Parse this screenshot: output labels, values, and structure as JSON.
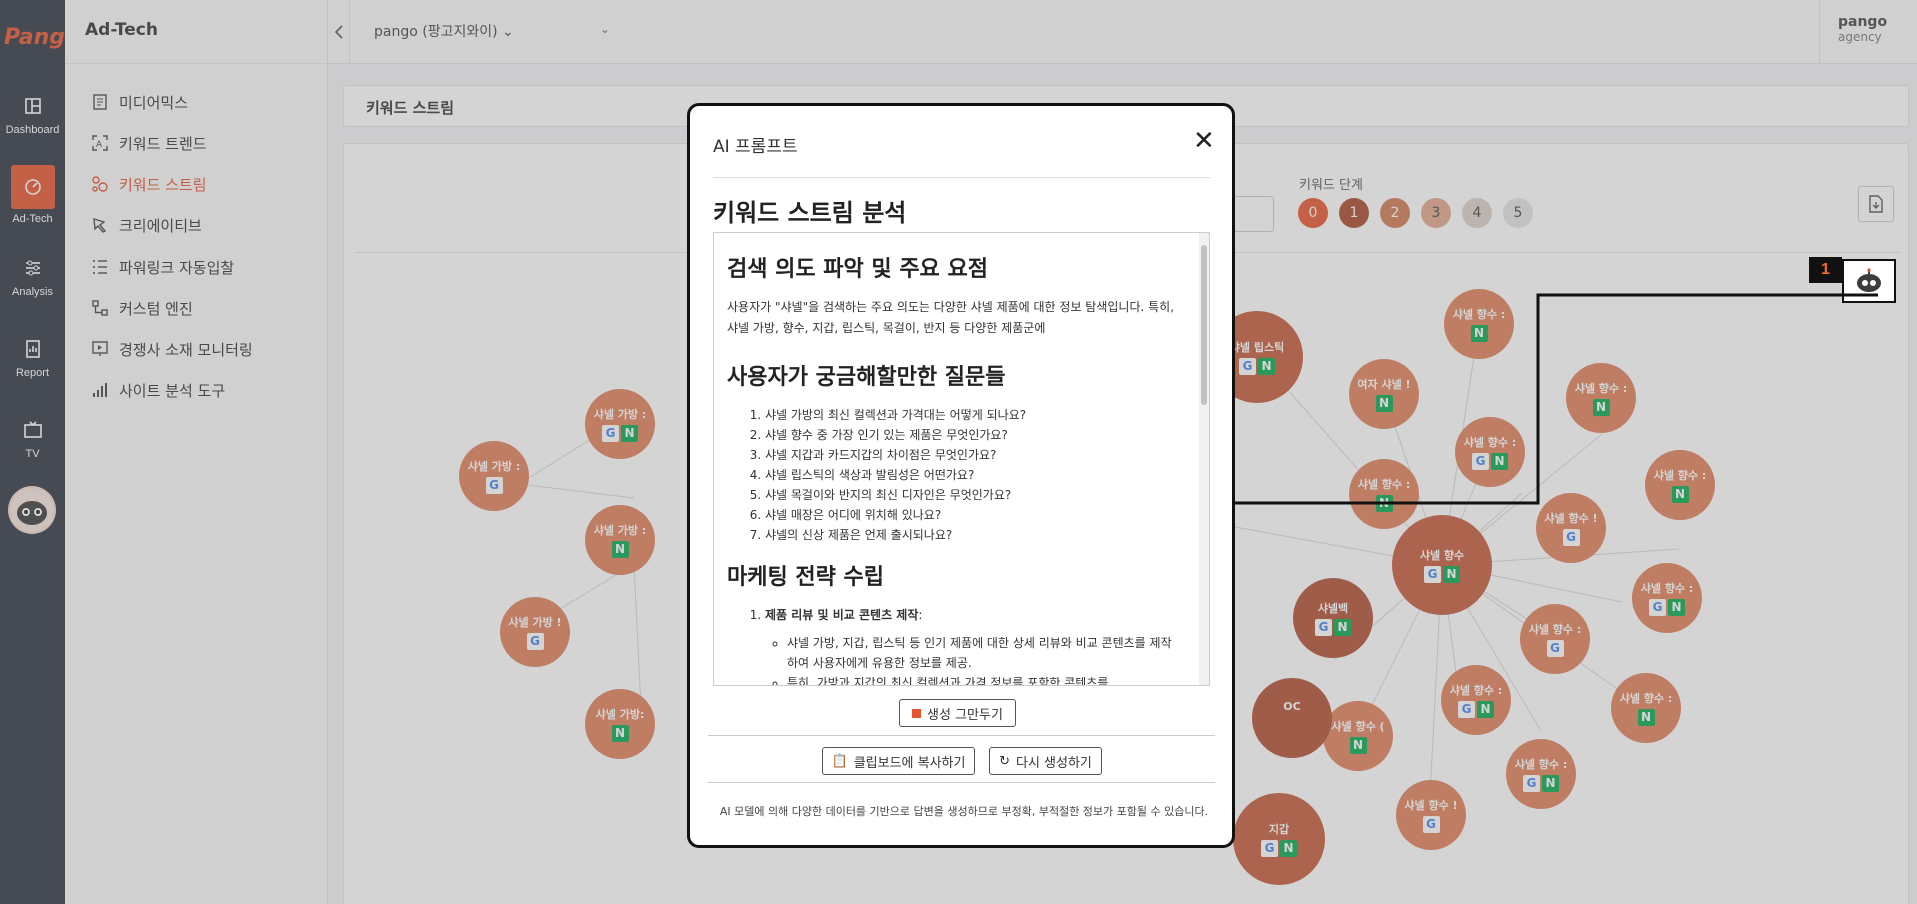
{
  "rail": {
    "logo_text": "Pango",
    "items": [
      {
        "label": "Dashboard",
        "icon": "dashboard-icon"
      },
      {
        "label": "Ad-Tech",
        "icon": "gauge-icon"
      },
      {
        "label": "Analysis",
        "icon": "sliders-icon"
      },
      {
        "label": "Report",
        "icon": "report-icon"
      },
      {
        "label": "TV",
        "icon": "tv-icon"
      }
    ]
  },
  "side": {
    "brand": "Ad-Tech",
    "items": [
      {
        "label": "미디어믹스"
      },
      {
        "label": "키워드 트렌드"
      },
      {
        "label": "키워드 스트림"
      },
      {
        "label": "크리에이티브"
      },
      {
        "label": "파워링크 자동입찰"
      },
      {
        "label": "커스텀 엔진"
      },
      {
        "label": "경쟁사 소재 모니터링"
      },
      {
        "label": "사이트 분석 도구"
      }
    ]
  },
  "header": {
    "account": "pango (팡고지와이)",
    "user_name": "pango",
    "user_role": "agency"
  },
  "breadcrumb": "키워드 스트림",
  "content": {
    "stage_title": "키워드 단계",
    "stages": [
      "0",
      "1",
      "2",
      "3",
      "4",
      "5"
    ],
    "nodes": [
      {
        "name": "샤넬 립스틱",
        "g": true,
        "n": true
      },
      {
        "name": "샤넬 향수 :",
        "g": false,
        "n": true
      },
      {
        "name": "여자 샤넬 !",
        "g": false,
        "n": true
      },
      {
        "name": "샤넬 향수 :",
        "g": false,
        "n": true
      },
      {
        "name": "샤넬 향수 :",
        "g": true,
        "n": true
      },
      {
        "name": "샤넬 향수 :",
        "g": false,
        "n": true
      },
      {
        "name": "샤넬 향수 :",
        "g": false,
        "n": true
      },
      {
        "name": "샤넬 향수 !",
        "g": true,
        "n": false
      },
      {
        "name": "샤넬 향수",
        "g": true,
        "n": true
      },
      {
        "name": "샤넬백",
        "g": true,
        "n": true
      },
      {
        "name": "샤넬 향수 :",
        "g": true,
        "n": true
      },
      {
        "name": "샤넬 향수 :",
        "g": true,
        "n": false
      },
      {
        "name": "샤넬 향수 :",
        "g": true,
        "n": true
      },
      {
        "name": "샤넬 향수 :",
        "g": false,
        "n": true
      },
      {
        "name": "샤넬 향수 (",
        "g": false,
        "n": true
      },
      {
        "name": "샤넬 향수 :",
        "g": true,
        "n": true
      },
      {
        "name": "샤넬 향수 !",
        "g": true,
        "n": false
      },
      {
        "name": "샤넬 가방 :",
        "g": true,
        "n": true
      },
      {
        "name": "샤넬 가방 :",
        "g": true,
        "n": false
      },
      {
        "name": "샤넬 가방 :",
        "g": false,
        "n": true
      },
      {
        "name": "샤넬 가방 !",
        "g": true,
        "n": false
      },
      {
        "name": "샤넬 가방:",
        "g": false,
        "n": true
      },
      {
        "name": "OC",
        "g": false,
        "n": false
      },
      {
        "name": "지갑",
        "g": true,
        "n": true
      }
    ]
  },
  "callout": {
    "number": "1",
    "icon": "ai-bot-icon"
  },
  "modal": {
    "title": "AI 프롬프트",
    "section_title": "키워드 스트림 분석",
    "h_intent": "검색 의도 파악 및 주요 요점",
    "p_intent": "사용자가 \"샤넬\"을 검색하는 주요 의도는 다양한 샤넬 제품에 대한 정보 탐색입니다. 특히, 샤넬 가방, 향수, 지갑, 립스틱, 목걸이, 반지 등 다양한 제품군에",
    "h_questions": "사용자가 궁금해할만한 질문들",
    "questions": [
      "샤넬 가방의 최신 컬렉션과 가격대는 어떻게 되나요?",
      "샤넬 향수 중 가장 인기 있는 제품은 무엇인가요?",
      "샤넬 지갑과 카드지갑의 차이점은 무엇인가요?",
      "샤넬 립스틱의 색상과 발림성은 어떤가요?",
      "샤넬 목걸이와 반지의 최신 디자인은 무엇인가요?",
      "샤넬 매장은 어디에 위치해 있나요?",
      "샤넬의 신상 제품은 언제 출시되나요?"
    ],
    "h_marketing": "마케팅 전략 수립",
    "strategy_title": "제품 리뷰 및 비교 콘텐츠 제작",
    "strategy_bullets": [
      "샤넬 가방, 지갑, 립스틱 등 인기 제품에 대한 상세 리뷰와 비교 콘텐츠를 제작하여 사용자에게 유용한 정보를 제공.",
      "특히, 가방과 지갑의 최신 컬렉션과 가격 정보를 포함한 콘텐츠를"
    ],
    "stop_label": "생성 그만두기",
    "copy_label": "클립보드에 복사하기",
    "regen_label": "다시 생성하기",
    "disclaimer": "AI 모델에 의해 다양한 데이터를 기반으로 답변을 생성하므로 부정확, 부적절한 정보가 포함될 수 있습니다."
  }
}
